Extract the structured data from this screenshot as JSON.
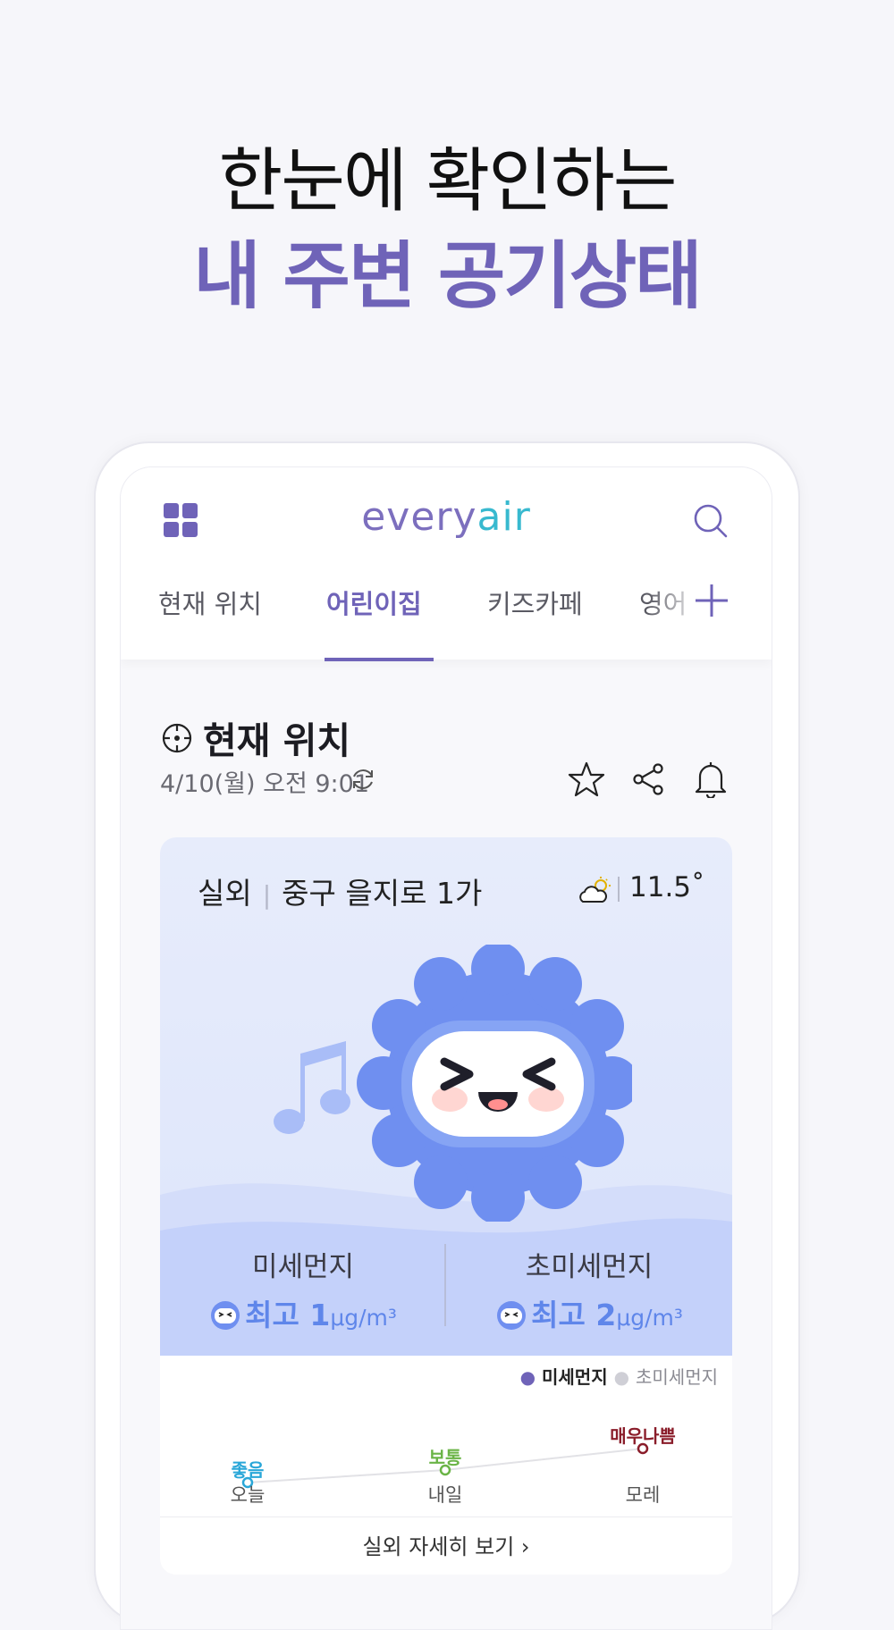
{
  "headline": {
    "line1": "한눈에 확인하는",
    "line2": "내 주변 공기상태"
  },
  "app": {
    "logo_part1": "every",
    "logo_part2": "air",
    "tabs": [
      {
        "label": "현재 위치",
        "active": false
      },
      {
        "label": "어린이집",
        "active": true
      },
      {
        "label": "키즈카페",
        "active": false
      },
      {
        "label": "영어",
        "active": false
      }
    ]
  },
  "location": {
    "title": "현재 위치",
    "datetime": "4/10(월) 오전 9:01"
  },
  "card": {
    "type_label": "실외",
    "address": "중구 을지로 1가",
    "temperature": "11.5˚",
    "pm10": {
      "label": "미세먼지",
      "grade": "최고",
      "value": "1",
      "unit": "μg/m³"
    },
    "pm25": {
      "label": "초미세먼지",
      "grade": "최고",
      "value": "2",
      "unit": "μg/m³"
    },
    "legend": {
      "primary": "미세먼지",
      "secondary": "초미세먼지"
    },
    "forecast": [
      {
        "day": "오늘",
        "status": "좋음",
        "color": "#2aa7d8"
      },
      {
        "day": "내일",
        "status": "보통",
        "color": "#6ab446"
      },
      {
        "day": "모레",
        "status": "매우나쁨",
        "color": "#8a1d2a"
      }
    ],
    "detail_link": "실외 자세히 보기 ›"
  },
  "colors": {
    "accent": "#6f63b8",
    "logo_teal": "#38b9cf",
    "mascot": "#6f8ff0"
  }
}
